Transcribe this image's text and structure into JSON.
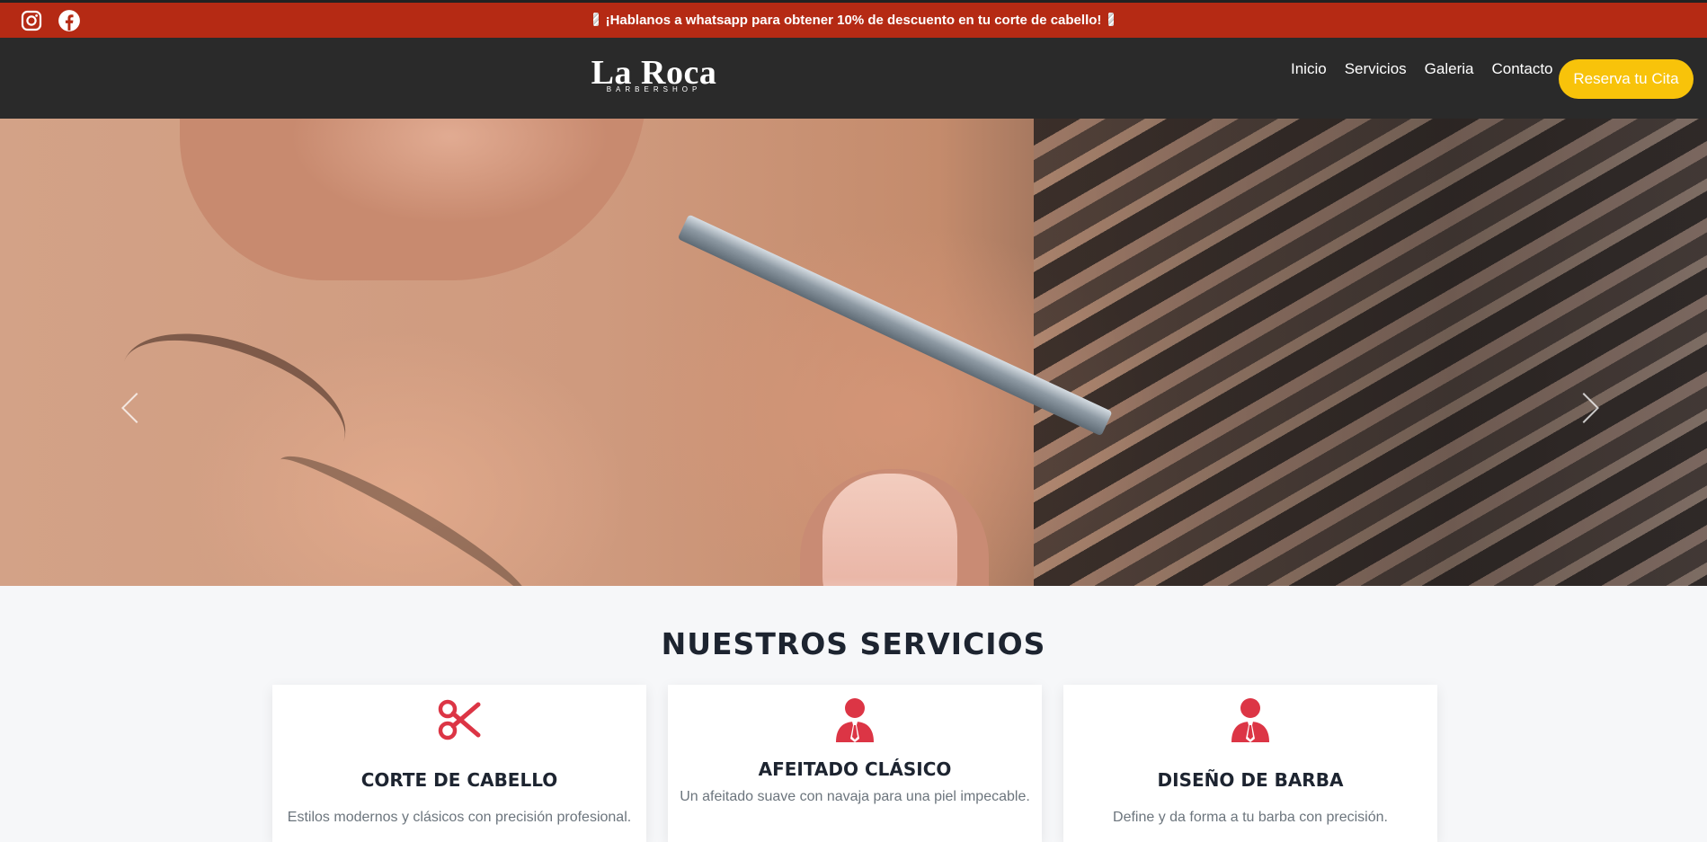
{
  "topbar": {
    "icons": [
      "instagram-icon",
      "facebook-icon"
    ],
    "promo": "¡Hablanos a whatsapp para obtener 10% de descuento en tu corte de cabello!"
  },
  "header": {
    "logo_main": "La Roca",
    "logo_sub": "BARBERSHOP",
    "nav": [
      "Inicio",
      "Servicios",
      "Galeria",
      "Contacto"
    ],
    "cta": "Reserva tu Cita"
  },
  "hero": {
    "slides_total": 3,
    "active_slide": 3
  },
  "services": {
    "title": "NUESTROS SERVICIOS",
    "cards": [
      {
        "icon": "scissors-icon",
        "title": "CORTE DE CABELLO",
        "text": "Estilos modernos y clásicos con precisión profesional."
      },
      {
        "icon": "person-tie-icon",
        "title": "AFEITADO CLÁSICO",
        "text": "Un afeitado suave con navaja para una piel impecable."
      },
      {
        "icon": "person-tie-icon",
        "title": "DISEÑO DE BARBA",
        "text": "Define y da forma a tu barba con precisión."
      }
    ]
  },
  "colors": {
    "topbar": "#b52a14",
    "navbar": "#2a2a2a",
    "cta": "#f8c30a",
    "icon_red": "#dc3545"
  }
}
